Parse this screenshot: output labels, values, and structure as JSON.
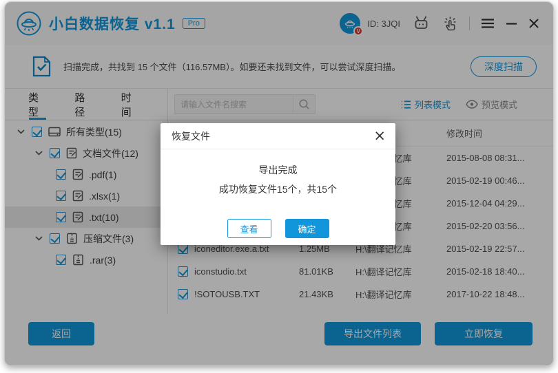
{
  "header": {
    "app_title": "小白数据恢复 v1.1",
    "pro_badge": "Pro",
    "user_id": "ID: 3JQI",
    "minimize_glyph": "—",
    "close_glyph": "×"
  },
  "scan_bar": {
    "message": "扫描完成，共找到 15 个文件（116.57MB）。如要还未找到文件，可以尝试深度扫描。",
    "deep_scan_label": "深度扫描"
  },
  "toolbar": {
    "tabs": [
      {
        "label": "类型"
      },
      {
        "label": "路径"
      },
      {
        "label": "时间"
      }
    ],
    "search_placeholder": "请输入文件名搜索",
    "list_mode_label": "列表模式",
    "preview_mode_label": "预览模式"
  },
  "tree": {
    "items": [
      {
        "label": "所有类型(15)"
      },
      {
        "label": "文档文件(12)"
      },
      {
        "label": ".pdf(1)"
      },
      {
        "label": ".xlsx(1)"
      },
      {
        "label": ".txt(10)"
      },
      {
        "label": "压缩文件(3)"
      },
      {
        "label": ".rar(3)"
      }
    ]
  },
  "file_list": {
    "time_column_header": "修改时间",
    "rows": [
      {
        "name": "",
        "size": "",
        "path": "H:\\翻译记忆库",
        "time": "2015-08-08 08:31..."
      },
      {
        "name": "",
        "size": "",
        "path": "H:\\翻译记忆库",
        "time": "2015-02-19 00:46..."
      },
      {
        "name": "",
        "size": "",
        "path": "H:\\翻译记忆库",
        "time": "2015-12-04 04:29..."
      },
      {
        "name": "",
        "size": "",
        "path": "H:\\翻译记忆库",
        "time": "2015-02-20 03:56..."
      },
      {
        "name": "iconeditor.exe.a.txt",
        "size": "1.25MB",
        "path": "H:\\翻译记忆库",
        "time": "2015-02-19 22:57..."
      },
      {
        "name": "iconstudio.txt",
        "size": "81.01KB",
        "path": "H:\\翻译记忆库",
        "time": "2015-02-18 18:40..."
      },
      {
        "name": "!SOTOUSB.TXT",
        "size": "21.43KB",
        "path": "H:\\翻译记忆库",
        "time": "2017-10-22 18:48..."
      }
    ]
  },
  "footer": {
    "back_label": "返回",
    "export_list_label": "导出文件列表",
    "recover_now_label": "立即恢复"
  },
  "modal": {
    "title": "恢复文件",
    "close_glyph": "×",
    "line1": "导出完成",
    "line2": "成功恢复文件15个，共15个",
    "view_label": "查看",
    "ok_label": "确定"
  },
  "colors": {
    "brand_blue": "#1296db",
    "badge_red": "#d6382c",
    "dim_overlay": "rgba(0,0,0,0.34)"
  }
}
